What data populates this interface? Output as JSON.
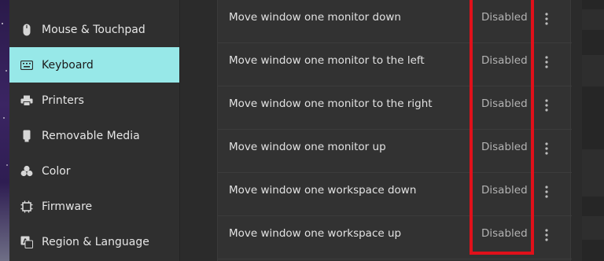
{
  "sidebar": {
    "items": [
      {
        "label": "Mouse & Touchpad",
        "icon": "mouse-icon",
        "active": false
      },
      {
        "label": "Keyboard",
        "icon": "keyboard-icon",
        "active": true
      },
      {
        "label": "Printers",
        "icon": "printer-icon",
        "active": false
      },
      {
        "label": "Removable Media",
        "icon": "removable-media-icon",
        "active": false
      },
      {
        "label": "Color",
        "icon": "color-icon",
        "active": false
      },
      {
        "label": "Firmware",
        "icon": "firmware-icon",
        "active": false
      },
      {
        "label": "Region & Language",
        "icon": "region-language-icon",
        "active": false
      }
    ]
  },
  "shortcuts": {
    "rows": [
      {
        "name": "Move window one monitor down",
        "value": "Disabled"
      },
      {
        "name": "Move window one monitor to the left",
        "value": "Disabled"
      },
      {
        "name": "Move window one monitor to the right",
        "value": "Disabled"
      },
      {
        "name": "Move window one monitor up",
        "value": "Disabled"
      },
      {
        "name": "Move window one workspace down",
        "value": "Disabled"
      },
      {
        "name": "Move window one workspace up",
        "value": "Disabled"
      }
    ]
  },
  "colors": {
    "active_item_bg": "#97e8e8",
    "highlight_border": "#e0101a"
  }
}
